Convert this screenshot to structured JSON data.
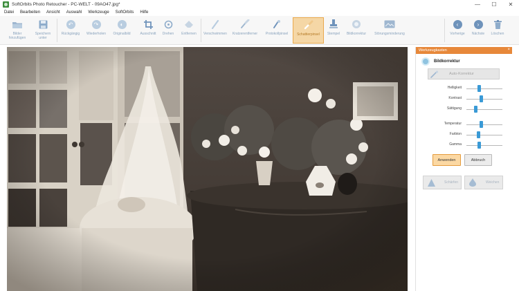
{
  "window": {
    "title": "SoftOrbits Photo Retoucher - PC-WELT - 09AO47.jpg*",
    "controls": {
      "minimize": "—",
      "maximize": "☐",
      "close": "✕"
    }
  },
  "menu": [
    "Datei",
    "Bearbeiten",
    "Ansicht",
    "Auswahl",
    "Werkzeuge",
    "SoftOrbits",
    "Hilfe"
  ],
  "toolbar": {
    "add_images": "Bilder hinzufügen",
    "save_as": "Speichern unter",
    "undo": "Rückgängig",
    "redo": "Wiederholen",
    "original": "Originalbild",
    "crop": "Ausschnitt",
    "rotate": "Drehen",
    "remove": "Entfernen",
    "blur": "Verschwimmen",
    "scratch_remover": "Kratzerentferner",
    "smart_brush": "Protokollpinsel",
    "retouch_brush": "Schattierpinsel",
    "stamp": "Stempel",
    "image_correction": "Bildkorrektur",
    "noise_reduction": "Störungsminderung",
    "previous": "Vorherige",
    "next": "Nächste",
    "delete": "Löschen"
  },
  "panel": {
    "title": "Werkzeugkasten",
    "close": "×",
    "header": "Bildkorrektur",
    "auto_button": "Auto-Korrektur",
    "sliders": [
      {
        "label": "Helligkeit",
        "value": 0.35
      },
      {
        "label": "Kontrast",
        "value": 0.42
      },
      {
        "label": "Sättigung",
        "value": 0.25
      },
      {
        "label": "Temperatur",
        "value": 0.42
      },
      {
        "label": "Farbton",
        "value": 0.33
      },
      {
        "label": "Gamma",
        "value": 0.35
      }
    ],
    "apply": "Anwenden",
    "cancel": "Abbruch",
    "effect_left": "Schärfen",
    "effect_right": "Weichen"
  },
  "colors": {
    "accent_orange": "#e7883a",
    "active_tool_bg": "#f5d7a6",
    "slider_thumb": "#3a9ad6",
    "toolbar_label": "#8aa3bd"
  }
}
